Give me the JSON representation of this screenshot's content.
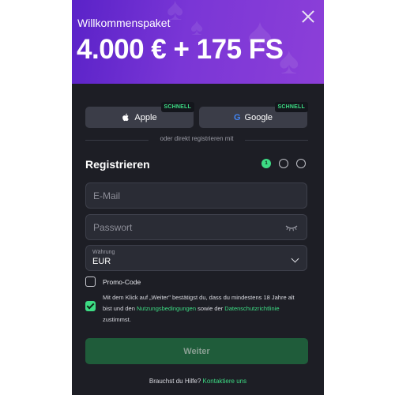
{
  "banner": {
    "welcome": "Willkommenspaket",
    "headline": "4.000 € + 175 FS"
  },
  "sso": {
    "apple_label": "Apple",
    "google_label": "Google",
    "badge": "SCHNELL"
  },
  "divider_text": "oder direkt registrieren mit",
  "form": {
    "title": "Registrieren",
    "steps": [
      "1",
      "",
      ""
    ],
    "email_placeholder": "E-Mail",
    "password_placeholder": "Passwort",
    "currency_label": "Währung",
    "currency_value": "EUR",
    "promo_label": "Promo-Code",
    "terms": {
      "part1": "Mit dem Klick auf „Weiter\" bestätigst du, dass du mindestens 18 Jahre alt bist und den ",
      "link1": "Nutzungsbedingungen",
      "part2": " sowie der ",
      "link2": "Datenschutzrichtlinie",
      "part3": " zustimmst."
    },
    "submit_label": "Weiter"
  },
  "help": {
    "text": "Brauchst du Hilfe? ",
    "link": "Kontaktiere uns"
  },
  "colors": {
    "accent": "#3ddc84",
    "banner_start": "#5a22c8",
    "banner_end": "#8c3fd8",
    "panel": "#1d1e25"
  }
}
